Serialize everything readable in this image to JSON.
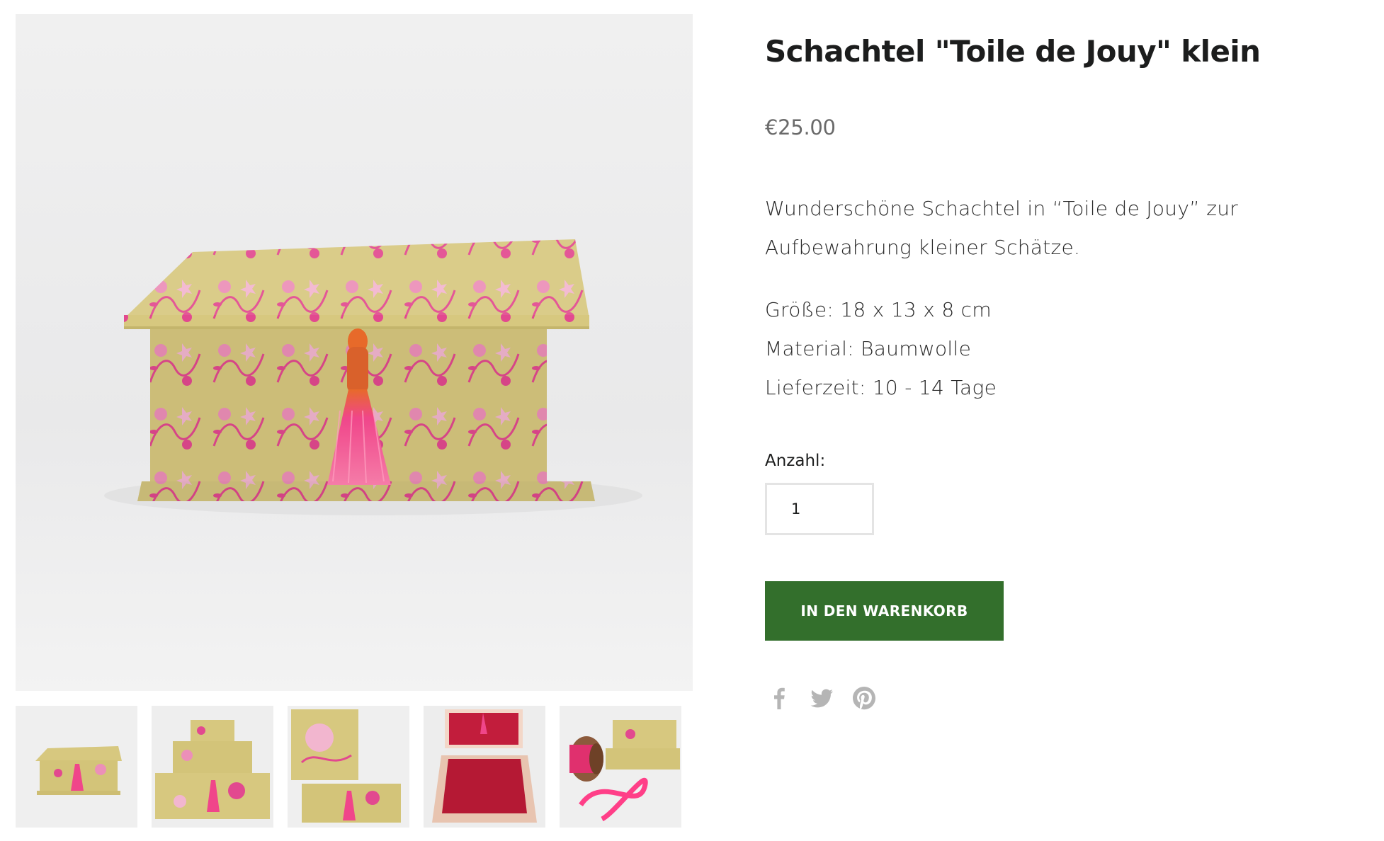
{
  "product": {
    "title": "Schachtel \"Toile de Jouy\" klein",
    "price": "€25.00",
    "description_intro": "Wunderschöne Schachtel in “Toile de Jouy” zur Aufbewahrung kleiner Schätze.",
    "specs": [
      "Größe: 18 x 13 x 8 cm",
      "Material: Baumwolle",
      "Lieferzeit: 10 - 14 Tage"
    ]
  },
  "form": {
    "quantity_label": "Anzahl:",
    "quantity_value": "1",
    "add_to_cart_label": "IN DEN WARENKORB"
  },
  "share": {
    "icons": [
      "facebook-icon",
      "twitter-icon",
      "pinterest-icon"
    ]
  },
  "gallery": {
    "thumbnail_count": 5
  },
  "colors": {
    "button_green": "#336f2c",
    "price_gray": "#6a6a6a",
    "share_icon_gray": "#b5b5b5",
    "box_fabric_yellow": "#d7c87f",
    "toile_pink": "#e2498f",
    "box_interior_red": "#c21d3c",
    "tassel_pink": "#f0468a"
  }
}
